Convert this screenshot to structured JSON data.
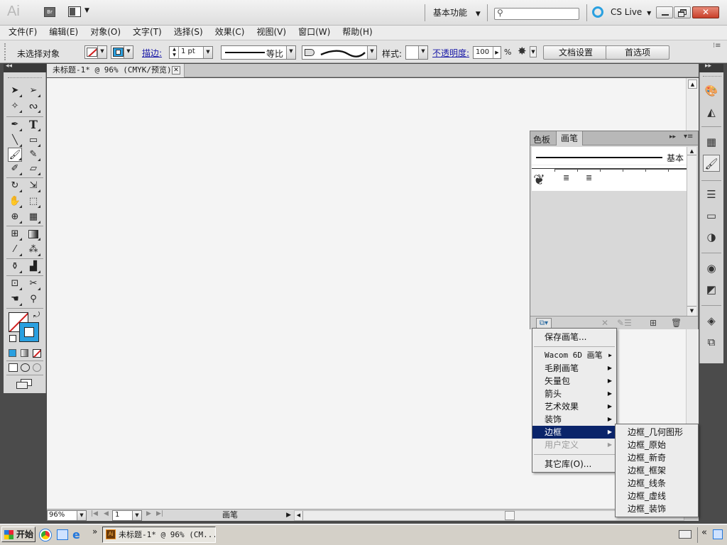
{
  "app": {
    "logo": "Ai",
    "bridge": "Br",
    "workspace": "基本功能",
    "search_placeholder": "",
    "cs_live": "CS Live"
  },
  "menu": [
    "文件(F)",
    "编辑(E)",
    "对象(O)",
    "文字(T)",
    "选择(S)",
    "效果(C)",
    "视图(V)",
    "窗口(W)",
    "帮助(H)"
  ],
  "control": {
    "no_selection": "未选择对象",
    "stroke_label": "描边:",
    "stroke_value": "1 pt",
    "profile_label": "等比",
    "style_label": "样式:",
    "opacity_label": "不透明度:",
    "opacity_value": "100",
    "opacity_unit": "%",
    "doc_setup": "文档设置",
    "prefs": "首选项"
  },
  "document": {
    "tab": "未标题-1* @ 96% (CMYK/预览)",
    "zoom": "96%",
    "page": "1",
    "status": "画笔"
  },
  "brush_panel": {
    "tab_swatches": "色板",
    "tab_brushes": "画笔",
    "basic_label": "基本"
  },
  "brush_menu": {
    "save": "保存画笔...",
    "items": [
      "Wacom 6D 画笔",
      "毛刷画笔",
      "矢量包",
      "箭头",
      "艺术效果",
      "装饰",
      "边框"
    ],
    "user_defined": "用户定义",
    "other": "其它库(O)..."
  },
  "submenu": [
    "边框_几何图形",
    "边框_原始",
    "边框_新奇",
    "边框_框架",
    "边框_线条",
    "边框_虚线",
    "边框_装饰"
  ],
  "taskbar": {
    "start": "开始",
    "task": "未标题-1* @ 96% (CM...",
    "more": "»"
  },
  "colors": {
    "highlight": "#0a246a",
    "accent_blue": "#2aa0e0",
    "canvas": "#f4f4f4"
  }
}
